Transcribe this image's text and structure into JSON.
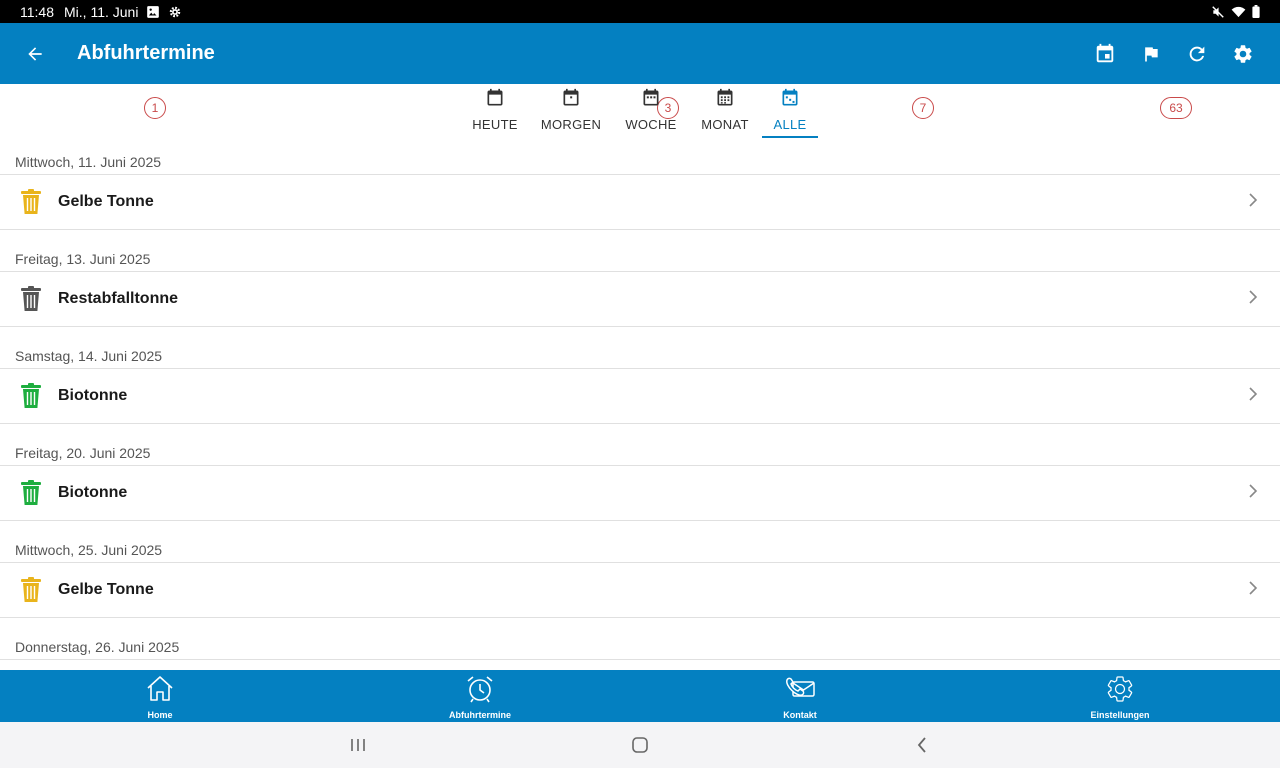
{
  "status_bar": {
    "time": "11:48",
    "date": "Mi., 11. Juni"
  },
  "app_bar": {
    "title": "Abfuhrtermine"
  },
  "tabs": [
    {
      "label": "HEUTE",
      "badge": "1",
      "active": false
    },
    {
      "label": "MORGEN",
      "badge": "",
      "active": false
    },
    {
      "label": "WOCHE",
      "badge": "3",
      "active": false
    },
    {
      "label": "MONAT",
      "badge": "7",
      "active": false
    },
    {
      "label": "ALLE",
      "badge": "63",
      "active": true
    }
  ],
  "groups": [
    {
      "date": "Mittwoch, 11. Juni 2025",
      "entry": "Gelbe Tonne",
      "bin_color": "#e9b41c"
    },
    {
      "date": "Freitag, 13. Juni 2025",
      "entry": "Restabfalltonne",
      "bin_color": "#555555"
    },
    {
      "date": "Samstag, 14. Juni 2025",
      "entry": "Biotonne",
      "bin_color": "#1eae3f"
    },
    {
      "date": "Freitag, 20. Juni 2025",
      "entry": "Biotonne",
      "bin_color": "#1eae3f"
    },
    {
      "date": "Mittwoch, 25. Juni 2025",
      "entry": "Gelbe Tonne",
      "bin_color": "#e9b41c"
    },
    {
      "date": "Donnerstag, 26. Juni 2025",
      "entry": "",
      "bin_color": ""
    }
  ],
  "bottom_nav": [
    {
      "label": "Home",
      "icon": "home-icon"
    },
    {
      "label": "Abfuhrtermine",
      "icon": "alarm-clock-icon"
    },
    {
      "label": "Kontakt",
      "icon": "phone-mail-icon"
    },
    {
      "label": "Einstellungen",
      "icon": "gear-icon"
    }
  ],
  "colors": {
    "primary": "#0480c1",
    "badge": "#c94a4a"
  }
}
